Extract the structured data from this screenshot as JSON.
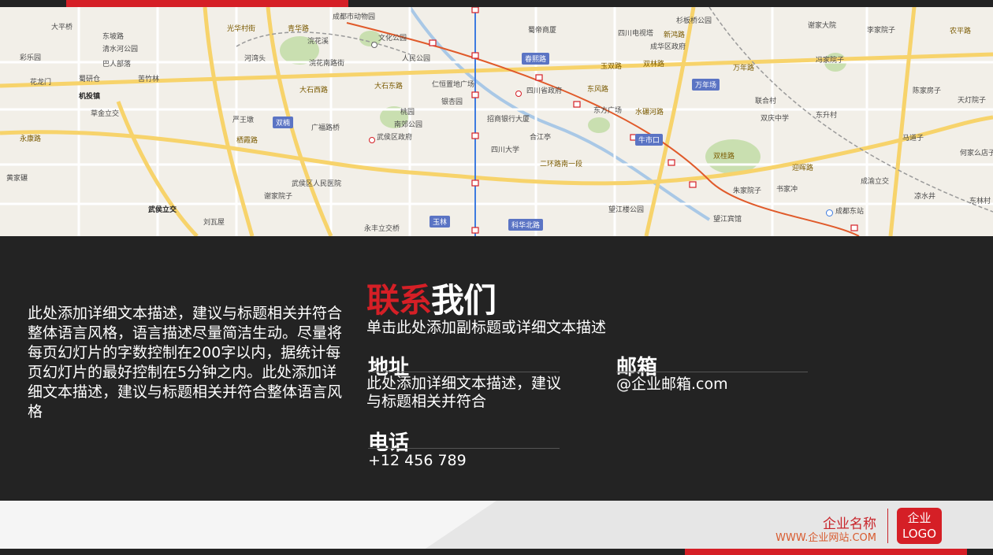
{
  "map": {
    "labels": [
      "大平桥",
      "东坡路",
      "清水河公园",
      "彩乐园",
      "巴人部落",
      "花龙门",
      "蜀研仓",
      "苦竹林",
      "机投镇",
      "草金立交",
      "永康路",
      "黄家碾",
      "光华村街",
      "青华路",
      "浣花溪",
      "河湾头",
      "浣花南路街",
      "大石西路",
      "双楠",
      "广福路桥",
      "严王墩",
      "栖霞路",
      "武侯区人民医院",
      "谢家院子",
      "武侯立交",
      "刘瓦屋",
      "成都市动物园",
      "文化公园",
      "人民公园",
      "大石东路",
      "仁恒置地广场",
      "桃园",
      "银杏园",
      "南郊公园",
      "武侯区政府",
      "招商银行大厦",
      "四川大学",
      "二环路南一段",
      "科华北路",
      "永丰立交桥",
      "玉林",
      "春熙路",
      "蜀帝商厦",
      "四川省政府",
      "合江亭",
      "四川电视塔",
      "杉板桥公园",
      "新鸿路",
      "成华区政府",
      "双林路",
      "玉双路",
      "东风路",
      "东方广场",
      "水碾河路",
      "牛市口",
      "双桂路",
      "望江楼公园",
      "朱家院子",
      "书家冲",
      "望江宾馆",
      "万年场",
      "万年路",
      "谢家大院",
      "李家院子",
      "冯家院子",
      "联合村",
      "双庆中学",
      "东升村",
      "迎晖路",
      "成都东站",
      "成渝立交",
      "凉水井",
      "农平路",
      "天灯院子",
      "陈家房子",
      "何家么店子",
      "马道子",
      "东林村"
    ],
    "badges": [
      "双楠",
      "春熙路",
      "万年场",
      "牛市口",
      "玉林",
      "科华北路"
    ]
  },
  "description": "此处添加详细文本描述，建议与标题相关并符合整体语言风格，语言描述尽量简洁生动。尽量将每页幻灯片的字数控制在200字以内，据统计每页幻灯片的最好控制在5分钟之内。此处添加详细文本描述，建议与标题相关并符合整体语言风格",
  "title": {
    "red": "联系",
    "white": "我们"
  },
  "subtitle": "单击此处添加副标题或详细文本描述",
  "contact": {
    "address_label": "地址",
    "address_value": "此处添加详细文本描述，建议与标题相关并符合",
    "email_label": "邮箱",
    "email_value": "@企业邮箱.com",
    "phone_label": "电话",
    "phone_value": "+12 456 789"
  },
  "footer": {
    "company_name": "企业名称",
    "company_url": "WWW.企业网站.COM",
    "logo_line1": "企业",
    "logo_line2": "LOGO"
  },
  "colors": {
    "accent": "#d51f26",
    "background": "#232323",
    "footer_bg": "#ececec"
  }
}
